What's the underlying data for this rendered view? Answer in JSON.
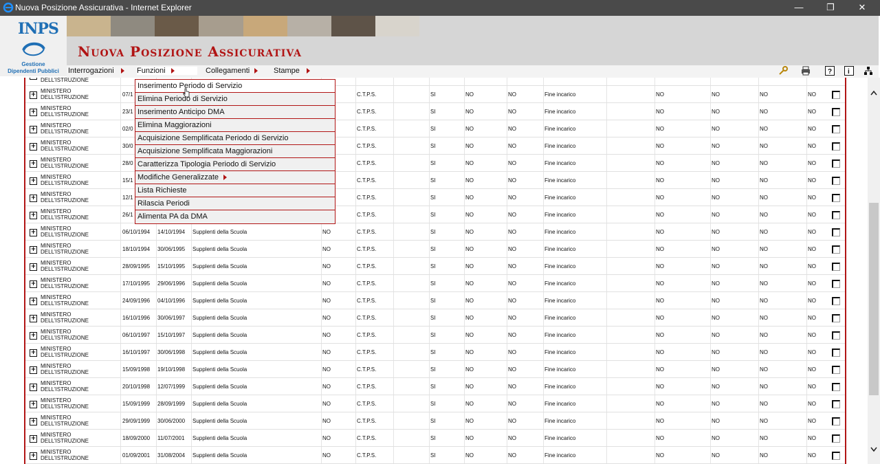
{
  "window": {
    "title": "Nuova Posizione Assicurativa - Internet Explorer",
    "controls": [
      "—",
      "❐",
      "✕"
    ]
  },
  "logo": {
    "text": "INPS",
    "subtitle_line1": "Gestione",
    "subtitle_line2": "Dipendenti Pubblici"
  },
  "app": {
    "title": "Nuova Posizione Assicurativa"
  },
  "menu": [
    {
      "label": "Interrogazioni"
    },
    {
      "label": "Funzioni"
    },
    {
      "label": "Collegamenti"
    },
    {
      "label": "Stampe"
    }
  ],
  "toolbar": [
    "key-icon",
    "printer-icon",
    "help-icon",
    "info-icon",
    "org-icon"
  ],
  "dropdown": [
    {
      "label": "Inserimento Periodo di Servizio"
    },
    {
      "label": "Elimina Periodo di Servizio"
    },
    {
      "label": "Inserimento Anticipo DMA"
    },
    {
      "label": "Elimina Maggiorazioni"
    },
    {
      "label": "Acquisizione Semplificata Periodo di Servizio"
    },
    {
      "label": "Acquisizione Semplificata Maggiorazioni"
    },
    {
      "label": "Caratterizza Tipologia Periodo di Servizio"
    },
    {
      "label": "Modifiche Generalizzate",
      "submenu": true
    },
    {
      "label": "Lista Richieste"
    },
    {
      "label": "Rilascia Periodi"
    },
    {
      "label": "Alimenta PA da DMA"
    }
  ],
  "table": {
    "top_partial_row": {
      "ente": "DELL'ISTRUZIONE"
    },
    "rows": [
      {
        "ente1": "MINISTERO",
        "ente2": "DELL'ISTRUZIONE",
        "dal": "07/1",
        "al": "",
        "desc": "",
        "flag": "",
        "cassa": "C.T.P.S.",
        "c1": "SI",
        "c2": "NO",
        "c3": "NO",
        "causa": "Fine incarico",
        "c5": "NO",
        "c6": "NO",
        "c7": "NO",
        "c8": "NO"
      },
      {
        "ente1": "MINISTERO",
        "ente2": "DELL'ISTRUZIONE",
        "dal": "23/1",
        "al": "",
        "desc": "",
        "flag": "",
        "cassa": "C.T.P.S.",
        "c1": "SI",
        "c2": "NO",
        "c3": "NO",
        "causa": "Fine incarico",
        "c5": "NO",
        "c6": "NO",
        "c7": "NO",
        "c8": "NO"
      },
      {
        "ente1": "MINISTERO",
        "ente2": "DELL'ISTRUZIONE",
        "dal": "02/0",
        "al": "",
        "desc": "",
        "flag": "",
        "cassa": "C.T.P.S.",
        "c1": "SI",
        "c2": "NO",
        "c3": "NO",
        "causa": "Fine incarico",
        "c5": "NO",
        "c6": "NO",
        "c7": "NO",
        "c8": "NO"
      },
      {
        "ente1": "MINISTERO",
        "ente2": "DELL'ISTRUZIONE",
        "dal": "30/0",
        "al": "",
        "desc": "",
        "flag": "",
        "cassa": "C.T.P.S.",
        "c1": "SI",
        "c2": "NO",
        "c3": "NO",
        "causa": "Fine incarico",
        "c5": "NO",
        "c6": "NO",
        "c7": "NO",
        "c8": "NO"
      },
      {
        "ente1": "MINISTERO",
        "ente2": "DELL'ISTRUZIONE",
        "dal": "28/0",
        "al": "",
        "desc": "",
        "flag": "",
        "cassa": "C.T.P.S.",
        "c1": "SI",
        "c2": "NO",
        "c3": "NO",
        "causa": "Fine incarico",
        "c5": "NO",
        "c6": "NO",
        "c7": "NO",
        "c8": "NO"
      },
      {
        "ente1": "MINISTERO",
        "ente2": "DELL'ISTRUZIONE",
        "dal": "15/1",
        "al": "",
        "desc": "",
        "flag": "",
        "cassa": "C.T.P.S.",
        "c1": "SI",
        "c2": "NO",
        "c3": "NO",
        "causa": "Fine incarico",
        "c5": "NO",
        "c6": "NO",
        "c7": "NO",
        "c8": "NO"
      },
      {
        "ente1": "MINISTERO",
        "ente2": "DELL'ISTRUZIONE",
        "dal": "12/1",
        "al": "",
        "desc": "",
        "flag": "",
        "cassa": "C.T.P.S.",
        "c1": "SI",
        "c2": "NO",
        "c3": "NO",
        "causa": "Fine incarico",
        "c5": "NO",
        "c6": "NO",
        "c7": "NO",
        "c8": "NO"
      },
      {
        "ente1": "MINISTERO",
        "ente2": "DELL'ISTRUZIONE",
        "dal": "26/1",
        "al": "",
        "desc": "",
        "flag": "",
        "cassa": "C.T.P.S.",
        "c1": "SI",
        "c2": "NO",
        "c3": "NO",
        "causa": "Fine incarico",
        "c5": "NO",
        "c6": "NO",
        "c7": "NO",
        "c8": "NO"
      },
      {
        "ente1": "MINISTERO",
        "ente2": "DELL'ISTRUZIONE",
        "dal": "06/10/1994",
        "al": "14/10/1994",
        "desc": "Supplenti della Scuola",
        "flag": "NO",
        "cassa": "C.T.P.S.",
        "c1": "SI",
        "c2": "NO",
        "c3": "NO",
        "causa": "Fine incarico",
        "c5": "NO",
        "c6": "NO",
        "c7": "NO",
        "c8": "NO"
      },
      {
        "ente1": "MINISTERO",
        "ente2": "DELL'ISTRUZIONE",
        "dal": "18/10/1994",
        "al": "30/06/1995",
        "desc": "Supplenti della Scuola",
        "flag": "NO",
        "cassa": "C.T.P.S.",
        "c1": "SI",
        "c2": "NO",
        "c3": "NO",
        "causa": "Fine incarico",
        "c5": "NO",
        "c6": "NO",
        "c7": "NO",
        "c8": "NO"
      },
      {
        "ente1": "MINISTERO",
        "ente2": "DELL'ISTRUZIONE",
        "dal": "28/09/1995",
        "al": "15/10/1995",
        "desc": "Supplenti della Scuola",
        "flag": "NO",
        "cassa": "C.T.P.S.",
        "c1": "SI",
        "c2": "NO",
        "c3": "NO",
        "causa": "Fine incarico",
        "c5": "NO",
        "c6": "NO",
        "c7": "NO",
        "c8": "NO"
      },
      {
        "ente1": "MINISTERO",
        "ente2": "DELL'ISTRUZIONE",
        "dal": "17/10/1995",
        "al": "29/06/1996",
        "desc": "Supplenti della Scuola",
        "flag": "NO",
        "cassa": "C.T.P.S.",
        "c1": "SI",
        "c2": "NO",
        "c3": "NO",
        "causa": "Fine incarico",
        "c5": "NO",
        "c6": "NO",
        "c7": "NO",
        "c8": "NO"
      },
      {
        "ente1": "MINISTERO",
        "ente2": "DELL'ISTRUZIONE",
        "dal": "24/09/1996",
        "al": "04/10/1996",
        "desc": "Supplenti della Scuola",
        "flag": "NO",
        "cassa": "C.T.P.S.",
        "c1": "SI",
        "c2": "NO",
        "c3": "NO",
        "causa": "Fine incarico",
        "c5": "NO",
        "c6": "NO",
        "c7": "NO",
        "c8": "NO"
      },
      {
        "ente1": "MINISTERO",
        "ente2": "DELL'ISTRUZIONE",
        "dal": "16/10/1996",
        "al": "30/06/1997",
        "desc": "Supplenti della Scuola",
        "flag": "NO",
        "cassa": "C.T.P.S.",
        "c1": "SI",
        "c2": "NO",
        "c3": "NO",
        "causa": "Fine incarico",
        "c5": "NO",
        "c6": "NO",
        "c7": "NO",
        "c8": "NO"
      },
      {
        "ente1": "MINISTERO",
        "ente2": "DELL'ISTRUZIONE",
        "dal": "06/10/1997",
        "al": "15/10/1997",
        "desc": "Supplenti della Scuola",
        "flag": "NO",
        "cassa": "C.T.P.S.",
        "c1": "SI",
        "c2": "NO",
        "c3": "NO",
        "causa": "Fine incarico",
        "c5": "NO",
        "c6": "NO",
        "c7": "NO",
        "c8": "NO"
      },
      {
        "ente1": "MINISTERO",
        "ente2": "DELL'ISTRUZIONE",
        "dal": "16/10/1997",
        "al": "30/06/1998",
        "desc": "Supplenti della Scuola",
        "flag": "NO",
        "cassa": "C.T.P.S.",
        "c1": "SI",
        "c2": "NO",
        "c3": "NO",
        "causa": "Fine incarico",
        "c5": "NO",
        "c6": "NO",
        "c7": "NO",
        "c8": "NO"
      },
      {
        "ente1": "MINISTERO",
        "ente2": "DELL'ISTRUZIONE",
        "dal": "15/09/1998",
        "al": "19/10/1998",
        "desc": "Supplenti della Scuola",
        "flag": "NO",
        "cassa": "C.T.P.S.",
        "c1": "SI",
        "c2": "NO",
        "c3": "NO",
        "causa": "Fine incarico",
        "c5": "NO",
        "c6": "NO",
        "c7": "NO",
        "c8": "NO"
      },
      {
        "ente1": "MINISTERO",
        "ente2": "DELL'ISTRUZIONE",
        "dal": "20/10/1998",
        "al": "12/07/1999",
        "desc": "Supplenti della Scuola",
        "flag": "NO",
        "cassa": "C.T.P.S.",
        "c1": "SI",
        "c2": "NO",
        "c3": "NO",
        "causa": "Fine incarico",
        "c5": "NO",
        "c6": "NO",
        "c7": "NO",
        "c8": "NO"
      },
      {
        "ente1": "MINISTERO",
        "ente2": "DELL'ISTRUZIONE",
        "dal": "15/09/1999",
        "al": "28/09/1999",
        "desc": "Supplenti della Scuola",
        "flag": "NO",
        "cassa": "C.T.P.S.",
        "c1": "SI",
        "c2": "NO",
        "c3": "NO",
        "causa": "Fine incarico",
        "c5": "NO",
        "c6": "NO",
        "c7": "NO",
        "c8": "NO"
      },
      {
        "ente1": "MINISTERO",
        "ente2": "DELL'ISTRUZIONE",
        "dal": "29/09/1999",
        "al": "30/06/2000",
        "desc": "Supplenti della Scuola",
        "flag": "NO",
        "cassa": "C.T.P.S.",
        "c1": "SI",
        "c2": "NO",
        "c3": "NO",
        "causa": "Fine incarico",
        "c5": "NO",
        "c6": "NO",
        "c7": "NO",
        "c8": "NO"
      },
      {
        "ente1": "MINISTERO",
        "ente2": "DELL'ISTRUZIONE",
        "dal": "18/09/2000",
        "al": "11/07/2001",
        "desc": "Supplenti della Scuola",
        "flag": "NO",
        "cassa": "C.T.P.S.",
        "c1": "SI",
        "c2": "NO",
        "c3": "NO",
        "causa": "Fine incarico",
        "c5": "NO",
        "c6": "NO",
        "c7": "NO",
        "c8": "NO"
      },
      {
        "ente1": "MINISTERO",
        "ente2": "DELL'ISTRUZIONE",
        "dal": "01/09/2001",
        "al": "31/08/2004",
        "desc": "Supplenti della Scuola",
        "flag": "NO",
        "cassa": "C.T.P.S.",
        "c1": "SI",
        "c2": "NO",
        "c3": "NO",
        "causa": "Fine incarico",
        "c5": "NO",
        "c6": "NO",
        "c7": "NO",
        "c8": "NO"
      }
    ]
  }
}
